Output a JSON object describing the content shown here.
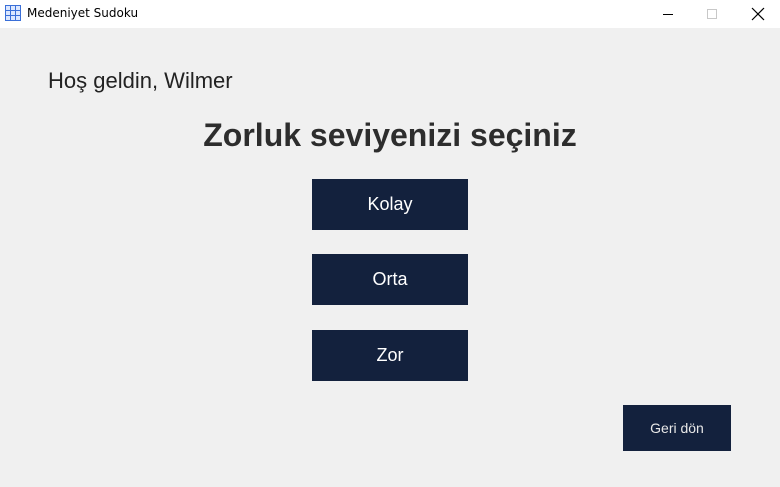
{
  "window": {
    "title": "Medeniyet Sudoku",
    "app_icon": "sudoku-grid-icon",
    "controls": {
      "minimize_icon": "minimize-icon",
      "maximize_icon": "maximize-icon",
      "close_icon": "close-icon"
    }
  },
  "main": {
    "greeting": "Hoş geldin, Wilmer",
    "heading": "Zorluk seviyenizi seçiniz",
    "levels": [
      {
        "label": "Kolay"
      },
      {
        "label": "Orta"
      },
      {
        "label": "Zor"
      }
    ],
    "back_label": "Geri dön"
  },
  "colors": {
    "button_bg": "#13213d",
    "background": "#f0f0f0",
    "text": "#2d2d2d"
  }
}
